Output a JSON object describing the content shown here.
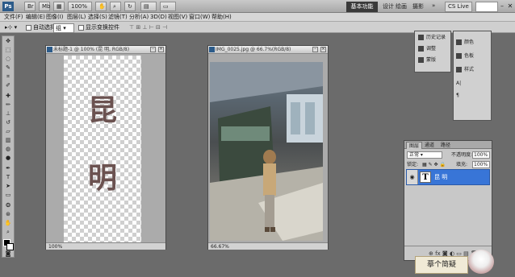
{
  "app": {
    "logo": "Ps",
    "zoom": "100%",
    "workspace_active": "基本功能",
    "workspaces": [
      "设计",
      "绘画",
      "摄影"
    ],
    "more": "»",
    "cs_live": "CS Live"
  },
  "menu": [
    "文件(F)",
    "编辑(E)",
    "图像(I)",
    "图层(L)",
    "选择(S)",
    "滤镜(T)",
    "分析(A)",
    "3D(D)",
    "视图(V)",
    "窗口(W)",
    "帮助(H)"
  ],
  "options": {
    "auto_select_label": "自动选择:",
    "auto_select_value": "组",
    "transform_label": "显示变换控件"
  },
  "doc1": {
    "title": "未标题-1 @ 100% (昆 明, RGB/8)",
    "text_top": "昆",
    "text_bottom": "明",
    "zoom": "100%"
  },
  "doc2": {
    "title": "IMG_0025.jpg @ 66.7%(RGB/8)",
    "zoom": "66.67%"
  },
  "float_panel": {
    "left": [
      "历史记录",
      "调整",
      "蒙版"
    ],
    "right": [
      "颜色",
      "色板",
      "样式"
    ]
  },
  "layers_panel": {
    "tabs": [
      "图层",
      "通道",
      "路径"
    ],
    "blend_mode": "正常",
    "opacity_label": "不透明度:",
    "opacity_value": "100%",
    "lock_label": "锁定:",
    "fill_label": "填充:",
    "fill_value": "100%",
    "layer_thumb": "T",
    "layer_name": "昆 明"
  },
  "watermark": {
    "text": "摹个简疑"
  }
}
